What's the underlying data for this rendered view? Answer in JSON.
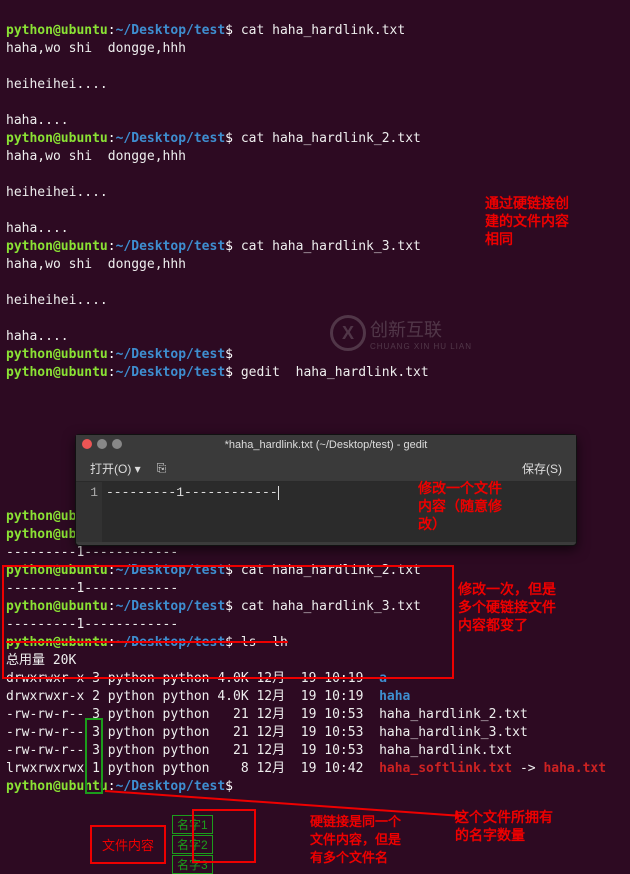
{
  "prompt": {
    "user": "python",
    "at": "@",
    "host": "ubuntu",
    "colon": ":",
    "path": "~/Desktop/test",
    "dollar": "$"
  },
  "cmds": {
    "cat1": "cat haha_hardlink.txt",
    "cat2": "cat haha_hardlink_2.txt",
    "cat3": "cat haha_hardlink_3.txt",
    "gedit": "gedit  haha_hardlink.txt",
    "ls": "ls  lh"
  },
  "output": {
    "l1": "haha,wo shi  dongge,hhh",
    "l2": "heiheihei....",
    "l3": "haha....",
    "mod": "---------1------------"
  },
  "annotations": {
    "a1_l1": "通过硬链接创",
    "a1_l2": "建的文件内容",
    "a1_l3": "相同",
    "a2_l1": "修改一个文件",
    "a2_l2": "内容（随意修",
    "a2_l3": "改）",
    "a3_l1": "修改一次，但是",
    "a3_l2": "多个硬链接文件",
    "a3_l3": "内容都变了",
    "a4_l1": "这个文件所拥有",
    "a4_l2": "的名字数量",
    "a5_l1": "硬链接是同一个",
    "a5_l2": "文件内容，但是",
    "a5_l3": "有多个文件名",
    "diagram_left": "文件内容",
    "diagram_n1": "名字1",
    "diagram_n2": "名字2",
    "diagram_n3": "名字3"
  },
  "gedit": {
    "title": "*haha_hardlink.txt (~/Desktop/test) - gedit",
    "open": "打开(O)",
    "save": "保存(S)",
    "line_no": "1",
    "content": "---------1------------"
  },
  "watermark": {
    "cn": "创新互联",
    "en": "CHUANG XIN HU LIAN",
    "x": "X"
  },
  "ls": {
    "total": "总用量 20K",
    "rows": [
      {
        "perm": "drwxrwxr-x",
        "n": "3",
        "own": "python python",
        "size": "4.0K",
        "date": "12月  19 10:19",
        "name": "a",
        "cls": "dir"
      },
      {
        "perm": "drwxrwxr-x",
        "n": "2",
        "own": "python python",
        "size": "4.0K",
        "date": "12月  19 10:19",
        "name": "haha",
        "cls": "dir"
      },
      {
        "perm": "-rw-rw-r--",
        "n": "3",
        "own": "python python",
        "size": "  21",
        "date": "12月  19 10:53",
        "name": "haha_hardlink_2.txt",
        "cls": "out"
      },
      {
        "perm": "-rw-rw-r--",
        "n": "3",
        "own": "python python",
        "size": "  21",
        "date": "12月  19 10:53",
        "name": "haha_hardlink_3.txt",
        "cls": "out"
      },
      {
        "perm": "-rw-rw-r--",
        "n": "3",
        "own": "python python",
        "size": "  21",
        "date": "12月  19 10:53",
        "name": "haha_hardlink.txt",
        "cls": "out"
      },
      {
        "perm": "lrwxrwxrwx",
        "n": "1",
        "own": "python python",
        "size": "   8",
        "date": "12月  19 10:42",
        "name": "haha_softlink.txt",
        "arrow": " -> ",
        "tgt": "haha.txt",
        "cls": "linkred"
      }
    ]
  }
}
